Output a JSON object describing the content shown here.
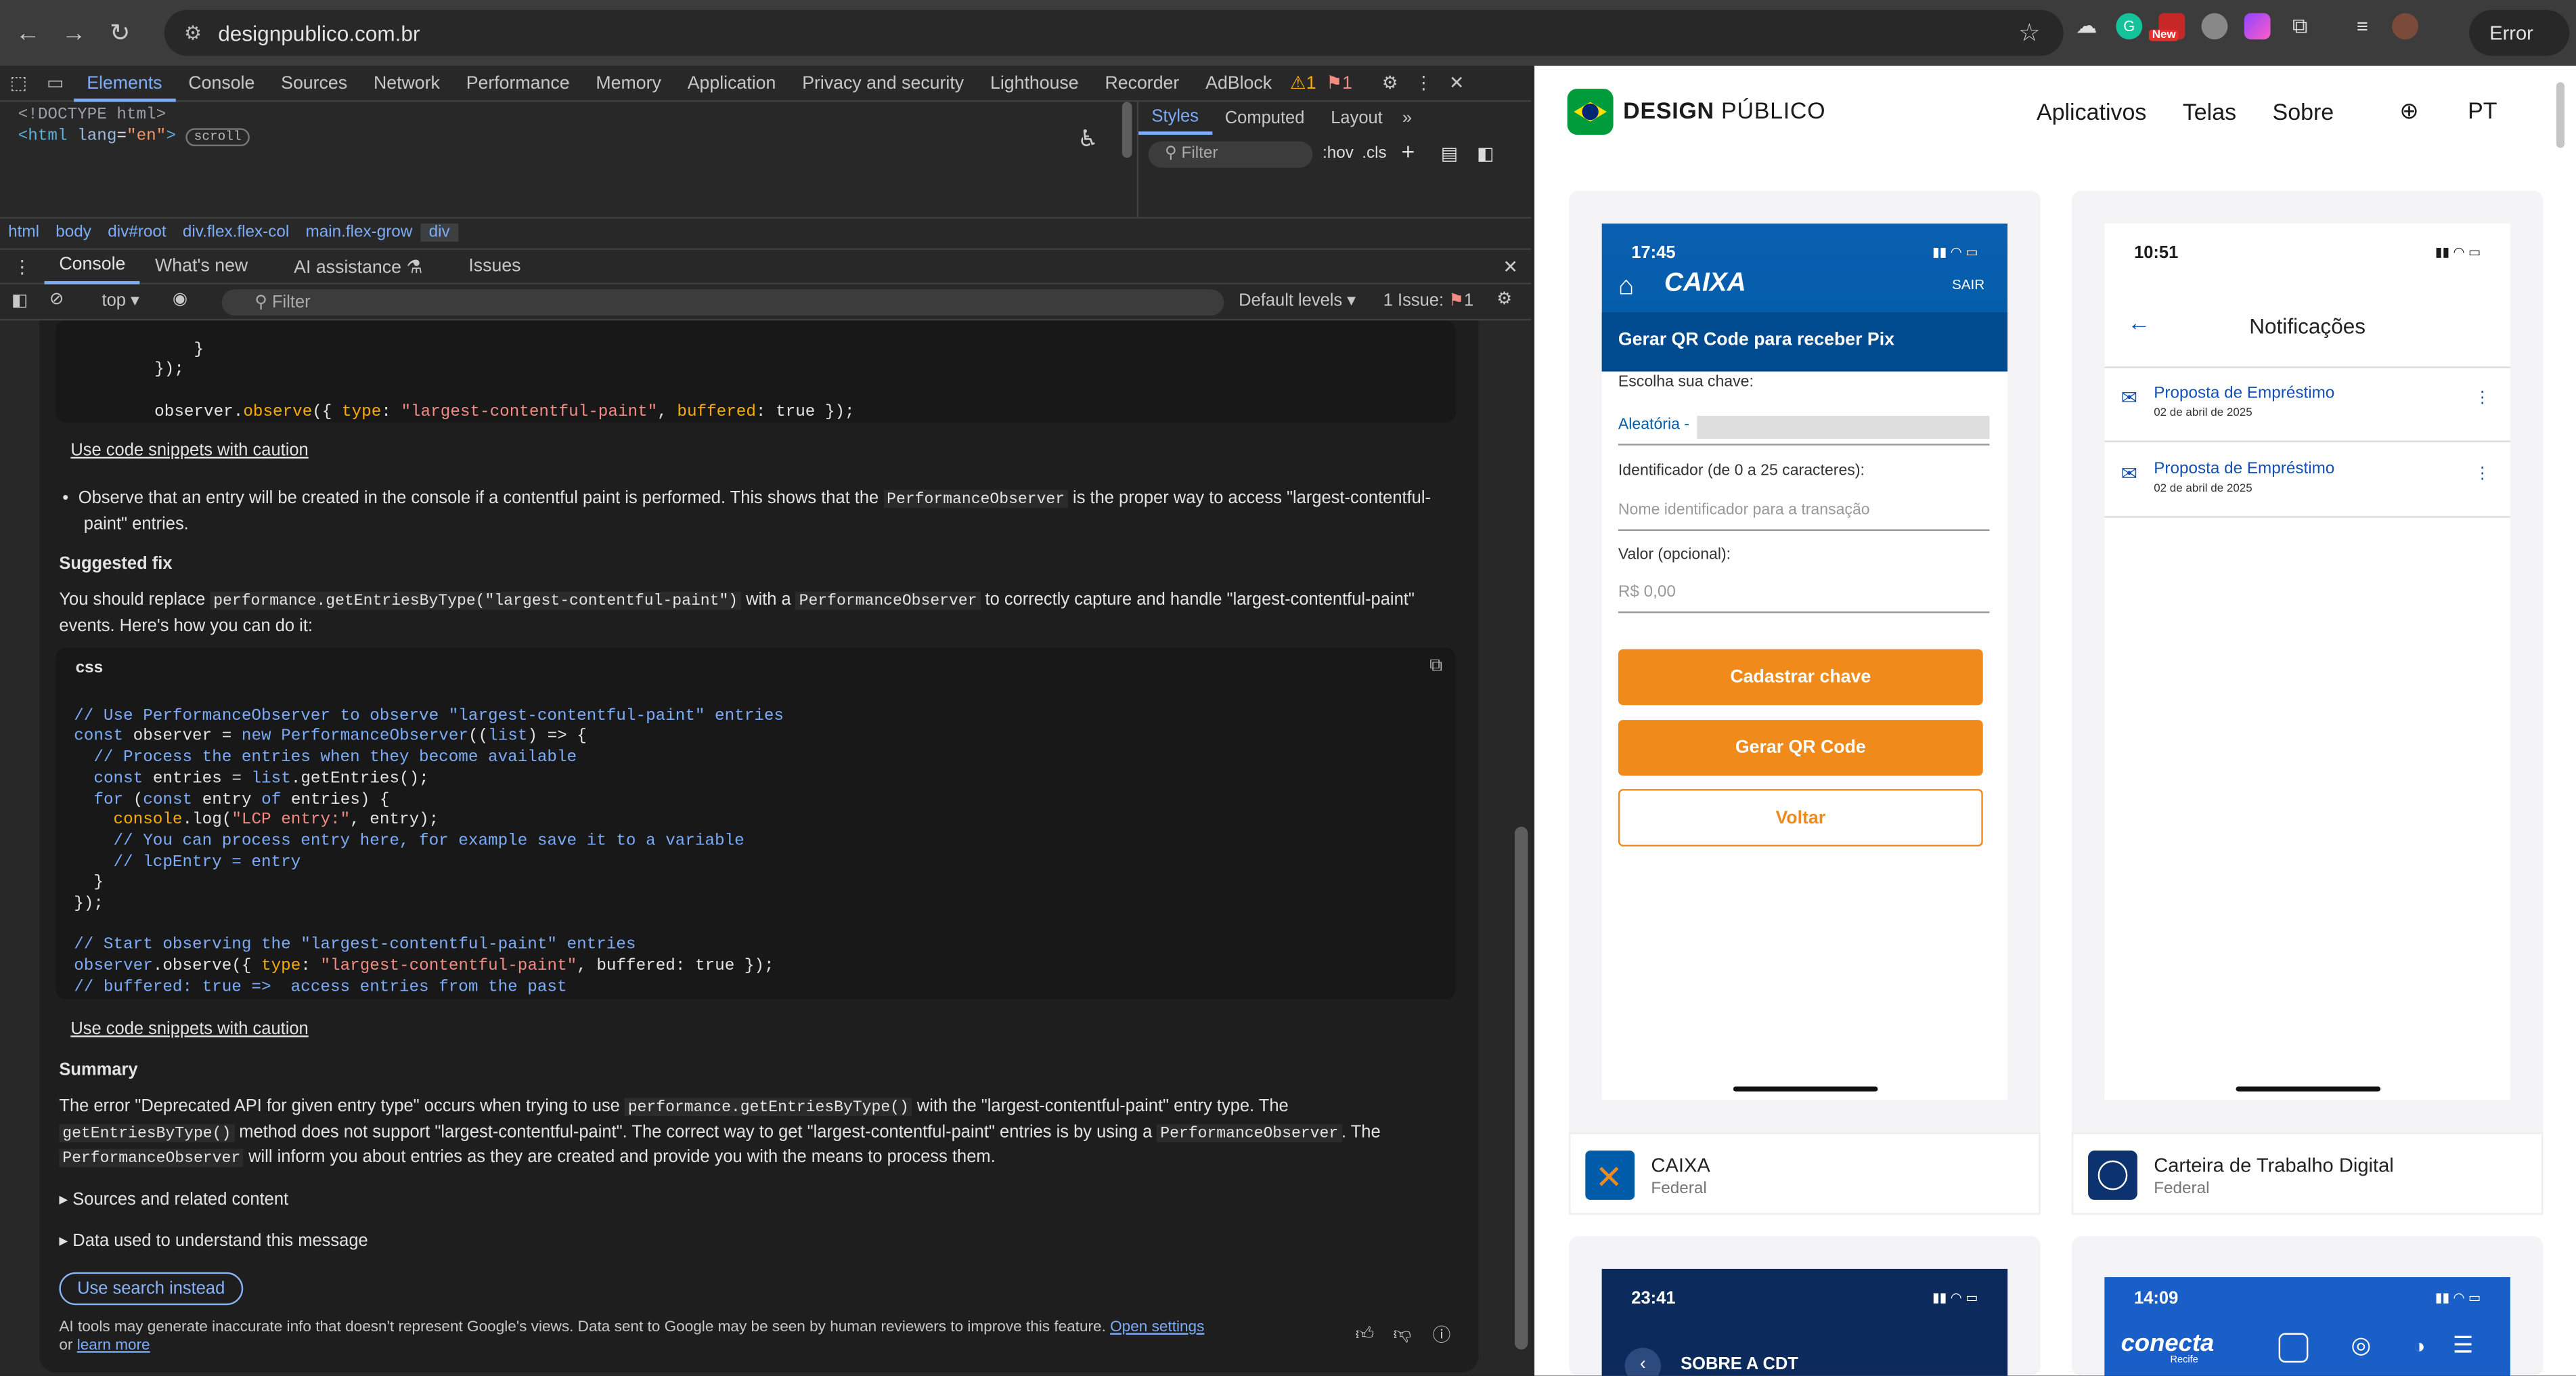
{
  "browser": {
    "url": "designpublico.com.br",
    "error_label": "Error",
    "new_badge": "New"
  },
  "devtools": {
    "tabs": [
      "Elements",
      "Console",
      "Sources",
      "Network",
      "Performance",
      "Memory",
      "Application",
      "Privacy and security",
      "Lighthouse",
      "Recorder",
      "AdBlock"
    ],
    "warn_count": "1",
    "issue_count": "1",
    "dom_line1": "<!DOCTYPE html>",
    "dom_line2_tag": "<html",
    "dom_line2_attr": "lang",
    "dom_line2_val": "\"en\"",
    "dom_line2_end": ">",
    "scroll_badge": "scroll",
    "styles_tabs": [
      "Styles",
      "Computed",
      "Layout"
    ],
    "styles_filter": "Filter",
    "styles_hov": ":hov",
    "styles_cls": ".cls",
    "breadcrumb": [
      "html",
      "body",
      "div#root",
      "div.flex.flex-col",
      "main.flex-grow",
      "div"
    ],
    "drawer_tabs": [
      "Console",
      "What's new",
      "AI assistance",
      "Issues"
    ],
    "console_context": "top",
    "console_filter": "Filter",
    "console_levels": "Default levels",
    "console_issue_label": "1 Issue:",
    "console_issue_count": "1"
  },
  "ai": {
    "code_top": [
      "            }",
      "        });",
      "",
      "        observer.observe({ type: \"largest-contentful-paint\", buffered: true });"
    ],
    "snippet_link": "Use code snippets with caution",
    "bullet_text_a": "Observe that an entry will be created in the console if a contentful paint is performed. This shows that the ",
    "bullet_code": "PerformanceObserver",
    "bullet_text_b": " is the proper way to access \"largest-contentful-",
    "bullet_text_c": "paint\" entries.",
    "suggested_heading": "Suggested fix",
    "suggest_a": "You should replace ",
    "suggest_code1": "performance.getEntriesByType(\"largest-contentful-paint\")",
    "suggest_b": " with a ",
    "suggest_code2": "PerformanceObserver",
    "suggest_c": " to correctly capture and handle \"largest-contentful-paint\"",
    "suggest_d": "events. Here's how you can do it:",
    "code_lang": "css",
    "code_lines": [
      "// Use PerformanceObserver to observe \"largest-contentful-paint\" entries",
      "const observer = new PerformanceObserver((list) => {",
      "  // Process the entries when they become available",
      "  const entries = list.getEntries();",
      "  for (const entry of entries) {",
      "    console.log(\"LCP entry:\", entry);",
      "    // You can process entry here, for example save it to a variable",
      "    // lcpEntry = entry",
      "  }",
      "});",
      "",
      "// Start observing the \"largest-contentful-paint\" entries",
      "observer.observe({ type: \"largest-contentful-paint\", buffered: true });",
      "// buffered: true =>  access entries from the past"
    ],
    "summary_heading": "Summary",
    "summary_a": "The error \"Deprecated API for given entry type\" occurs when trying to use ",
    "summary_code1": "performance.getEntriesByType()",
    "summary_b": " with the \"largest-contentful-paint\" entry type. The",
    "summary_code2": "getEntriesByType()",
    "summary_c": " method does not support \"largest-contentful-paint\". The correct way to get \"largest-contentful-paint\" entries is by using a ",
    "summary_code3": "PerformanceObserver",
    "summary_d": ". The",
    "summary_code4": "PerformanceObserver",
    "summary_e": " will inform you about entries as they are created and provide you with the means to process them.",
    "sources_toggle": "Sources and related content",
    "data_toggle": "Data used to understand this message",
    "search_button": "Use search instead",
    "disclaimer_a": "AI tools may generate inaccurate info that doesn't represent Google's views. Data sent to Google may be seen by human reviewers to improve this feature. ",
    "disclaimer_link1": "Open settings",
    "disclaimer_b": "or ",
    "disclaimer_link2": "learn more"
  },
  "site": {
    "brand_a": "DESIGN",
    "brand_b": "PÚBLICO",
    "nav": [
      "Aplicativos",
      "Telas",
      "Sobre"
    ],
    "lang": "PT",
    "caixa_phone": {
      "time": "17:45",
      "logo": "CAIXA",
      "sair": "SAIR",
      "banner": "Gerar QR Code para receber Pix",
      "key_label": "Escolha sua chave:",
      "key_value": "Aleatória -",
      "id_label": "Identificador (de 0 a 25 caracteres):",
      "id_placeholder": "Nome identificador para a transação",
      "value_label": "Valor (opcional):",
      "value_placeholder": "R$ 0,00",
      "btn1": "Cadastrar chave",
      "btn2": "Gerar QR Code",
      "btn3": "Voltar"
    },
    "ctps_phone": {
      "time": "10:51",
      "title": "Notificações",
      "items": [
        {
          "title": "Proposta de Empréstimo",
          "date": "02 de abril de 2025"
        },
        {
          "title": "Proposta de Empréstimo",
          "date": "02 de abril de 2025"
        }
      ]
    },
    "apps": [
      {
        "name": "CAIXA",
        "category": "Federal"
      },
      {
        "name": "Carteira de Trabalho Digital",
        "category": "Federal"
      }
    ],
    "cdt_phone": {
      "time": "23:41",
      "title": "SOBRE A CDT"
    },
    "conecta_phone": {
      "time": "14:09",
      "logo": "conecta",
      "logo_sub": "Recife"
    }
  }
}
